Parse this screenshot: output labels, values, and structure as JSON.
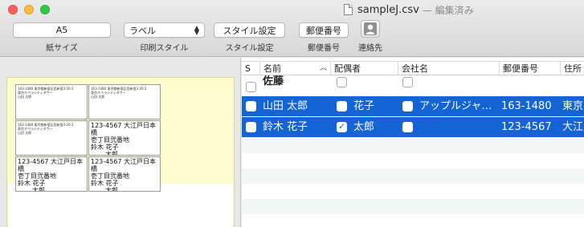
{
  "window": {
    "title": "sampleJ.csv",
    "subtitle": "— 編集済み"
  },
  "toolbar": {
    "paper_size_value": "A5",
    "paper_size_label": "紙サイズ",
    "print_style_value": "ラベル",
    "print_style_label": "印刷スタイル",
    "style_settings_button": "スタイル設定",
    "style_settings_label": "スタイル設定",
    "postal_code_button": "郵便番号",
    "postal_code_label": "郵便番号",
    "contacts_label": "連絡先"
  },
  "preview": {
    "small_label_lines": [
      "163-1480 東京都新宿区西新宿3-20-2",
      "東京オペラシティタワー",
      "山田 太郎"
    ],
    "big_label_lines": [
      "123-4567 大江戸日本橋",
      "壱丁目弐番地",
      "鈴木 花子",
      "太郎"
    ]
  },
  "table": {
    "columns": [
      "S",
      "名前",
      "配偶者",
      "会社名",
      "郵便番号",
      "住所"
    ],
    "rows": [
      {
        "name": "佐藤",
        "spouse": "",
        "spouse_checked": false,
        "company": "",
        "postal": "",
        "address": "",
        "selected": false
      },
      {
        "name": "山田 太郎",
        "spouse": "花子",
        "spouse_checked": false,
        "company": "アップルジャ…",
        "postal": "163-1480",
        "address": "東京",
        "selected": true
      },
      {
        "name": "鈴木 花子",
        "spouse": "太郎",
        "spouse_checked": true,
        "company": "",
        "postal": "123-4567",
        "address": "大江",
        "selected": true
      }
    ]
  },
  "colors": {
    "selection": "#1464d6",
    "preview_page": "#fffdd0"
  }
}
